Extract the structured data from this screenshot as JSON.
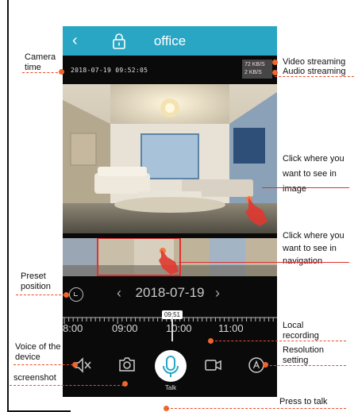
{
  "app": {
    "title": "office",
    "camera_time": "2018-07-19 09:52:05",
    "video_rate": "72 KB/S",
    "audio_rate": "2 KB/S"
  },
  "playback": {
    "date": "2018-07-19",
    "cursor_time": "09:51",
    "timeline_labels": [
      "8:00",
      "09:00",
      "10:00",
      "11:00"
    ]
  },
  "controls": {
    "talk_label": "Talk"
  },
  "annotations": {
    "camera_time": "Camera time",
    "video_streaming": "Video streaming",
    "audio_streaming": "Audio streaming",
    "click_image": "Click where you want to see in image",
    "click_nav": "Click where you want to see in navigation",
    "preset": "Preset position",
    "local_recording": "Local recording",
    "voice": "Voice of the device",
    "resolution": "Resolution setting",
    "screenshot": "screenshot",
    "press_talk": "Press to talk"
  },
  "icons": [
    "back-icon",
    "lock-icon",
    "preset-icon",
    "chevron-left-icon",
    "chevron-right-icon",
    "speaker-mute-icon",
    "camera-icon",
    "microphone-icon",
    "video-record-icon",
    "resolution-icon",
    "hand-pointer-icon"
  ],
  "colors": {
    "appbar": "#2aa6c5",
    "highlight": "#e03030",
    "annotation_dot": "#f0662c"
  }
}
